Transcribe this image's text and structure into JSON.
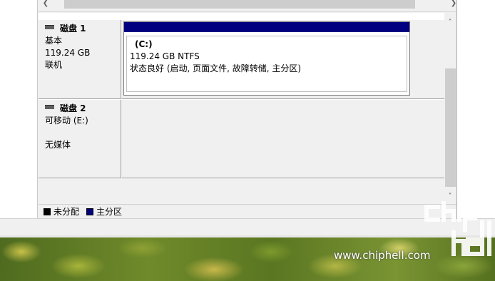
{
  "disks": [
    {
      "name": "磁盘 1",
      "type": "基本",
      "size": "119.24 GB",
      "status": "联机",
      "volume": {
        "name": "(C:)",
        "size_fs": "119.24 GB NTFS",
        "health": "状态良好 (启动, 页面文件, 故障转储, 主分区)",
        "bar_color": "#000080"
      }
    },
    {
      "name": "磁盘 2",
      "type": "可移动 (E:)",
      "size": "",
      "status": "无媒体"
    }
  ],
  "legend": {
    "unallocated": {
      "label": "未分配",
      "color": "#000000"
    },
    "primary": {
      "label": "主分区",
      "color": "#000080"
    }
  },
  "watermark": {
    "url": "www.chiphell.com",
    "logo_text": "chip hell"
  }
}
